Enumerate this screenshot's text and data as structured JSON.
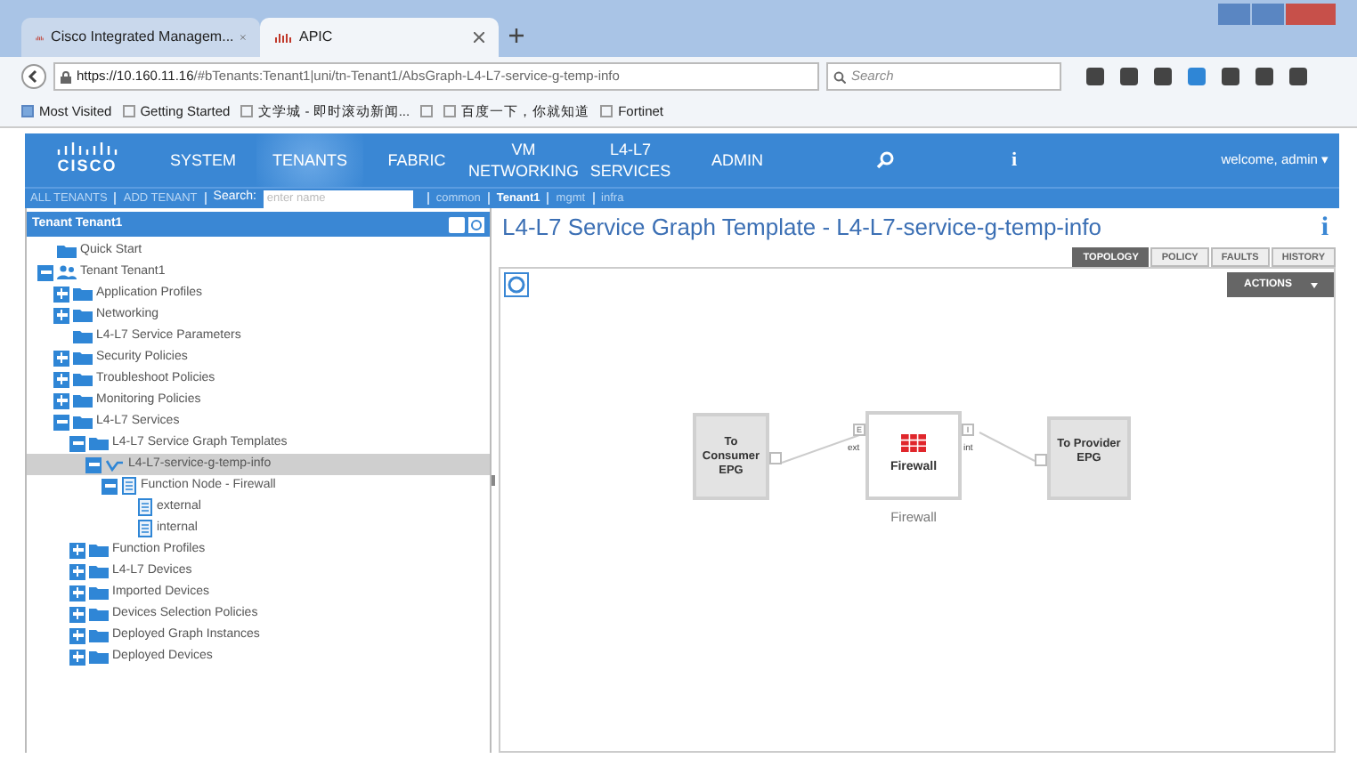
{
  "browser": {
    "tabs": [
      {
        "label": "Cisco Integrated Managem...",
        "selected": false
      },
      {
        "label": "APIC",
        "selected": true
      }
    ],
    "url": {
      "host": "https://10.160.11.16",
      "path": "/#bTenants:Tenant1|uni/tn-Tenant1/AbsGraph-L4-L7-service-g-temp-info"
    },
    "search_placeholder": "Search",
    "bookmarks": [
      {
        "label": "Most Visited"
      },
      {
        "label": "Getting Started"
      },
      {
        "label": "文学城 - 即时滚动新闻..."
      },
      {
        "kind": "blank"
      },
      {
        "label": "百度一下，你就知道"
      },
      {
        "label": "Fortinet"
      }
    ]
  },
  "nav": {
    "logo": "CISCO",
    "items": [
      {
        "label": "SYSTEM",
        "selected": false
      },
      {
        "label": "TENANTS",
        "selected": true
      },
      {
        "label": "FABRIC",
        "selected": false
      },
      {
        "label": "VM NETWORKING",
        "selected": false
      },
      {
        "label": "L4-L7 SERVICES",
        "selected": false
      },
      {
        "label": "ADMIN",
        "selected": false
      }
    ],
    "info": "i",
    "user": "welcome, admin ▾"
  },
  "subnav": {
    "links": [
      "ALL TENANTS",
      "ADD TENANT"
    ],
    "search_label": "Search:",
    "search_placeholder": "enter name",
    "tenants": [
      {
        "label": "common",
        "selected": false
      },
      {
        "label": "Tenant1",
        "selected": true
      },
      {
        "label": "mgmt",
        "selected": false
      },
      {
        "label": "infra",
        "selected": false
      }
    ]
  },
  "sidebar": {
    "title": "Tenant Tenant1",
    "tree": [
      {
        "label": "Quick Start",
        "kind": "folder",
        "selected": false
      },
      {
        "label": "Tenant Tenant1",
        "kind": "tenant",
        "expanded": true,
        "selected": false,
        "children": [
          {
            "label": "Application Profiles",
            "kind": "folder",
            "expanded": false,
            "selected": false
          },
          {
            "label": "Networking",
            "kind": "folder",
            "expanded": false,
            "selected": false
          },
          {
            "label": "L4-L7 Service Parameters",
            "kind": "folder",
            "selected": false
          },
          {
            "label": "Security Policies",
            "kind": "folder",
            "expanded": false,
            "selected": false
          },
          {
            "label": "Troubleshoot Policies",
            "kind": "folder",
            "expanded": false,
            "selected": false
          },
          {
            "label": "Monitoring Policies",
            "kind": "folder",
            "expanded": false,
            "selected": false
          },
          {
            "label": "L4-L7 Services",
            "kind": "folder",
            "expanded": true,
            "selected": false,
            "children": [
              {
                "label": "L4-L7 Service Graph Templates",
                "kind": "folder",
                "expanded": true,
                "selected": false,
                "children": [
                  {
                    "label": "L4-L7-service-g-temp-info",
                    "kind": "graph",
                    "expanded": true,
                    "selected": true,
                    "children": [
                      {
                        "label": "Function Node - Firewall",
                        "kind": "doc",
                        "expanded": true,
                        "selected": false,
                        "children": [
                          {
                            "label": "external",
                            "kind": "doc",
                            "selected": false
                          },
                          {
                            "label": "internal",
                            "kind": "doc",
                            "selected": false
                          }
                        ]
                      }
                    ]
                  }
                ]
              },
              {
                "label": "Function Profiles",
                "kind": "folder",
                "expanded": false,
                "selected": false
              },
              {
                "label": "L4-L7 Devices",
                "kind": "folder",
                "expanded": false,
                "selected": false
              },
              {
                "label": "Imported Devices",
                "kind": "folder",
                "expanded": false,
                "selected": false
              },
              {
                "label": "Devices Selection Policies",
                "kind": "folder",
                "expanded": false,
                "selected": false
              },
              {
                "label": "Deployed Graph Instances",
                "kind": "folder",
                "expanded": false,
                "selected": false
              },
              {
                "label": "Deployed Devices",
                "kind": "folder",
                "expanded": false,
                "selected": false
              }
            ]
          }
        ]
      }
    ]
  },
  "main": {
    "title": "L4-L7 Service Graph Template - L4-L7-service-g-temp-info",
    "info": "i",
    "tabs": [
      {
        "label": "TOPOLOGY",
        "selected": true
      },
      {
        "label": "POLICY",
        "selected": false
      },
      {
        "label": "FAULTS",
        "selected": false
      },
      {
        "label": "HISTORY",
        "selected": false
      }
    ],
    "actions": "ACTIONS",
    "graph": {
      "consumer": "To Consumer EPG",
      "node": {
        "label": "Firewall",
        "caption": "Firewall",
        "ext_port": "E",
        "ext_label": "ext",
        "int_port": "I",
        "int_label": "int"
      },
      "provider": "To Provider EPG"
    }
  }
}
